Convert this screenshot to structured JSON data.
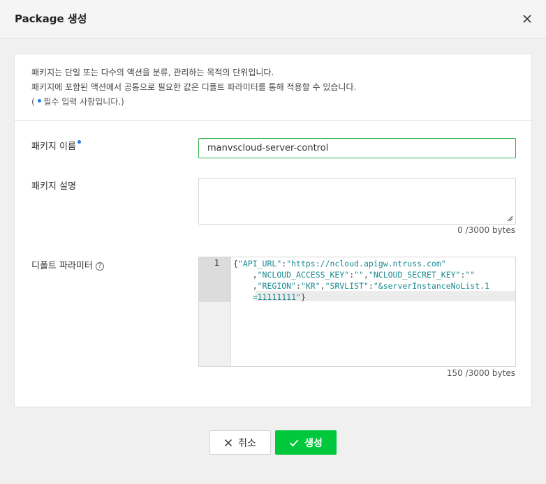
{
  "dialog": {
    "title": "Package 생성",
    "close_icon": "close-icon"
  },
  "description": {
    "line1": "패키지는 단일 또는 다수의 액션을 분류, 관리하는 목적의 단위입니다.",
    "line2": "패키지에 포함된 액션에서 공통으로 필요한 값은 디폴트 파라미터를 통해 적용할 수 있습니다.",
    "required_prefix": "(",
    "required_text": " 필수 입력 사항입니다.)"
  },
  "form": {
    "name": {
      "label": "패키지 이름",
      "value": "manvscloud-server-control"
    },
    "desc": {
      "label": "패키지 설명",
      "value": "",
      "counter": "0 /3000 bytes"
    },
    "params": {
      "label": "디폴트 파라미터",
      "help_icon": "question-circle-icon",
      "line_number": "1",
      "code_lines": [
        [
          "{",
          "\"API_URL\"",
          ":",
          "\"https://ncloud.apigw.ntruss.com\""
        ],
        [
          "    ,",
          "\"NCLOUD_ACCESS_KEY\"",
          ":",
          "\"\"",
          ",",
          "\"NCLOUD_SECRET_KEY\"",
          ":",
          "\"\""
        ],
        [
          "    ,",
          "\"REGION\"",
          ":",
          "\"KR\"",
          ",",
          "\"SRVLIST\"",
          ":",
          "\"&serverInstanceNoList.1"
        ],
        [
          "    ",
          "=11111111\"",
          "}"
        ]
      ],
      "counter": "150 /3000 bytes"
    }
  },
  "buttons": {
    "cancel_label": "취소",
    "cancel_icon": "close-icon",
    "create_label": "생성",
    "create_icon": "check-icon"
  },
  "colors": {
    "accent_green": "#00c73c",
    "required_dot": "#1e7be8",
    "input_focus_border": "#2bb249"
  }
}
